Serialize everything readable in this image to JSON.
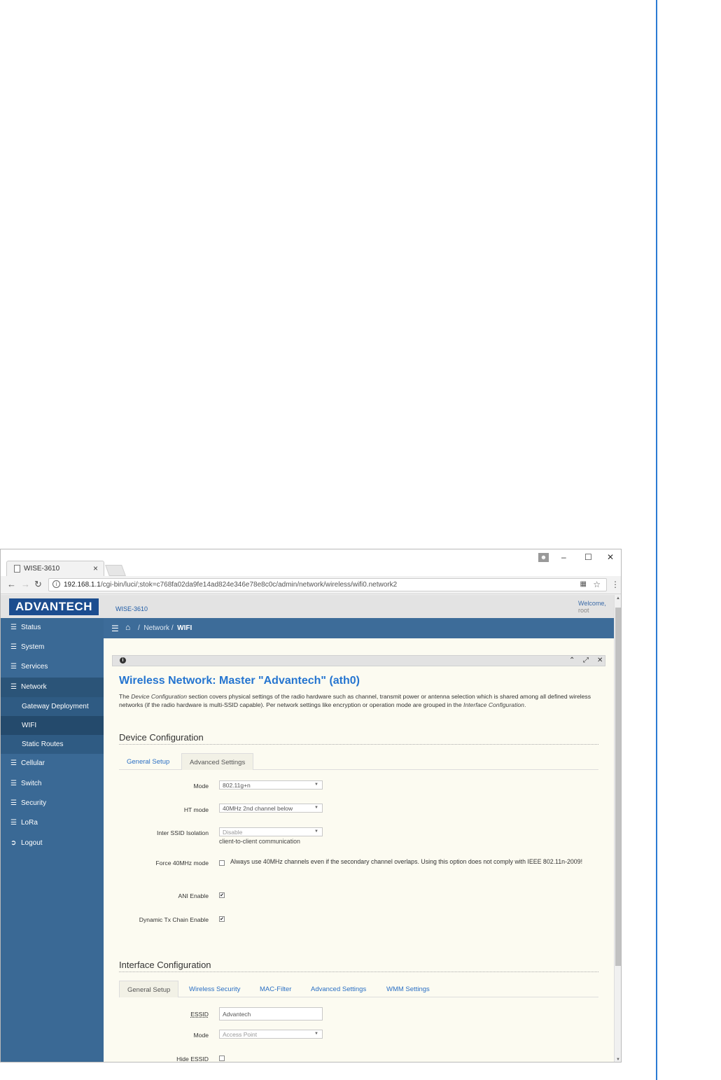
{
  "browser": {
    "tab_title": "WISE-3610",
    "tab_close": "×",
    "url_host": "192.168.1.1",
    "url_path": "/cgi-bin/luci/;stok=c768fa02da9fe14ad824e346e78e8c0c/admin/network/wireless/wifi0.network2",
    "window_minimize": "–",
    "window_maximize": "☐",
    "window_close": "✕"
  },
  "header": {
    "logo": "ADVANTECH",
    "product": "WISE-3610",
    "welcome": "Welcome,",
    "user": "root"
  },
  "sidebar": {
    "items": [
      {
        "label": "Status"
      },
      {
        "label": "System"
      },
      {
        "label": "Services"
      },
      {
        "label": "Network"
      },
      {
        "label": "Cellular"
      },
      {
        "label": "Switch"
      },
      {
        "label": "Security"
      },
      {
        "label": "LoRa"
      },
      {
        "label": "Logout"
      }
    ],
    "network_sub": [
      {
        "label": "Gateway Deployment"
      },
      {
        "label": "WIFI"
      },
      {
        "label": "Static Routes"
      }
    ]
  },
  "breadcrumb": {
    "separator": "/",
    "parent": "Network",
    "current": "WIFI"
  },
  "page": {
    "title": "Wireless Network: Master \"Advantech\" (ath0)",
    "desc_part1": "The ",
    "desc_em1": "Device Configuration",
    "desc_part2": " section covers physical settings of the radio hardware such as channel, transmit power or antenna selection which is shared among all defined wireless networks (if the radio hardware is multi-SSID capable). Per network settings like encryption or operation mode are grouped in the ",
    "desc_em2": "Interface Configuration",
    "desc_part3": "."
  },
  "device_config": {
    "heading": "Device Configuration",
    "tabs": [
      "General Setup",
      "Advanced Settings"
    ],
    "mode_label": "Mode",
    "mode_value": "802.11g+n",
    "ht_label": "HT mode",
    "ht_value": "40MHz 2nd channel below",
    "isolation_label": "Inter SSID Isolation",
    "isolation_value": "Disable",
    "isolation_hint": "client-to-client communication",
    "force40_label": "Force 40MHz mode",
    "force40_text": "Always use 40MHz channels even if the secondary channel overlaps. Using this option does not comply with IEEE 802.11n-2009!",
    "ani_label": "ANI Enable",
    "dtx_label": "Dynamic Tx Chain Enable"
  },
  "interface_config": {
    "heading": "Interface Configuration",
    "tabs": [
      "General Setup",
      "Wireless Security",
      "MAC-Filter",
      "Advanced Settings",
      "WMM Settings"
    ],
    "essid_label": "ESSID",
    "essid_value": "Advantech",
    "mode_label": "Mode",
    "mode_value": "Access Point",
    "hide_label": "Hide ESSID"
  }
}
